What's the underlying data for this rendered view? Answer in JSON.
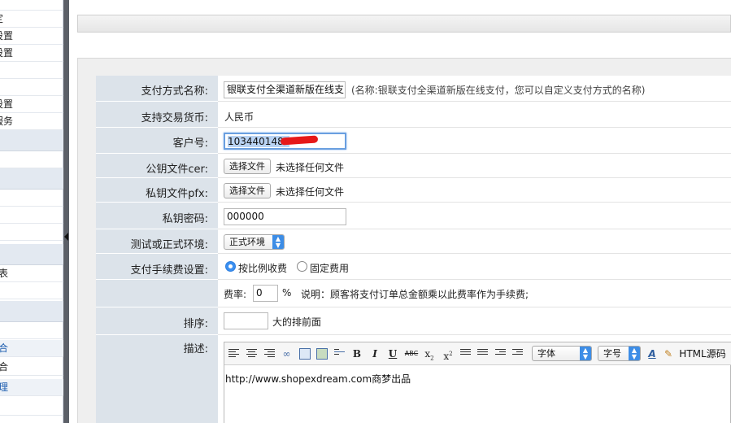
{
  "sidebar": {
    "items": [
      "设置",
      "设置",
      "设置",
      "服务",
      "表",
      "合",
      "合",
      "理"
    ]
  },
  "form": {
    "name": {
      "label": "支付方式名称:",
      "value": "银联支付全渠道新版在线支",
      "hint": "(名称:银联支付全渠道新版在线支付，您可以自定义支付方式的名称)"
    },
    "currency": {
      "label": "支持交易货币:",
      "value": "人民币"
    },
    "customer": {
      "label": "客户号:",
      "value": "1034401489"
    },
    "cert": {
      "label": "公钥文件cer:",
      "button": "选择文件",
      "status": "未选择任何文件"
    },
    "pfx": {
      "label": "私钥文件pfx:",
      "button": "选择文件",
      "status": "未选择任何文件"
    },
    "password": {
      "label": "私钥密码:",
      "value": "000000"
    },
    "env": {
      "label": "测试或正式环境:",
      "selected": "正式环境"
    },
    "fee": {
      "label": "支付手续费设置:",
      "option1": "按比例收费",
      "option2": "固定费用",
      "option1_checked": true
    },
    "rate": {
      "label": "费率:",
      "value": "0",
      "unit": "%",
      "note": "说明：顾客将支付订单总金额乘以此费率作为手续费;"
    },
    "order": {
      "label": "排序:",
      "value": "",
      "hint": "大的排前面"
    },
    "desc": {
      "label": "描述:",
      "font_select": "字体",
      "size_select": "字号",
      "html_button": "HTML源码",
      "content": "http://www.shopexdream.com商梦出品"
    }
  }
}
